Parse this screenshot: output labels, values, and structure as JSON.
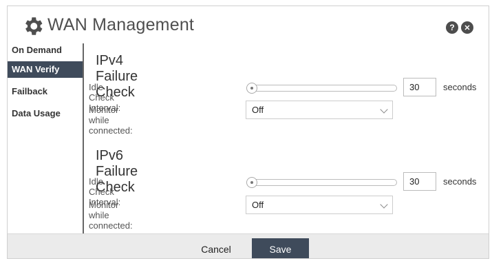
{
  "header": {
    "title": "WAN Management",
    "help_label": "?",
    "close_label": "✕",
    "icon": "gear-icon"
  },
  "sidebar": {
    "items": [
      {
        "label": "On Demand",
        "active": false
      },
      {
        "label": "WAN Verify",
        "active": true
      },
      {
        "label": "Failback",
        "active": false
      },
      {
        "label": "Data Usage",
        "active": false
      }
    ]
  },
  "ipv4": {
    "title": "IPv4 Failure Check",
    "idle_label": "Idle Check Interval:",
    "idle_value": "30",
    "idle_unit": "seconds",
    "monitor_label": "Monitor while connected:",
    "monitor_value": "Off"
  },
  "ipv6": {
    "title": "IPv6 Failure Check",
    "idle_label": "Idle Check Interval:",
    "idle_value": "30",
    "idle_unit": "seconds",
    "monitor_label": "Monitor while connected:",
    "monitor_value": "Off"
  },
  "footer": {
    "cancel_label": "Cancel",
    "save_label": "Save"
  },
  "colors": {
    "active_bg": "#3f4b5b",
    "footer_bg": "#ebebeb"
  }
}
